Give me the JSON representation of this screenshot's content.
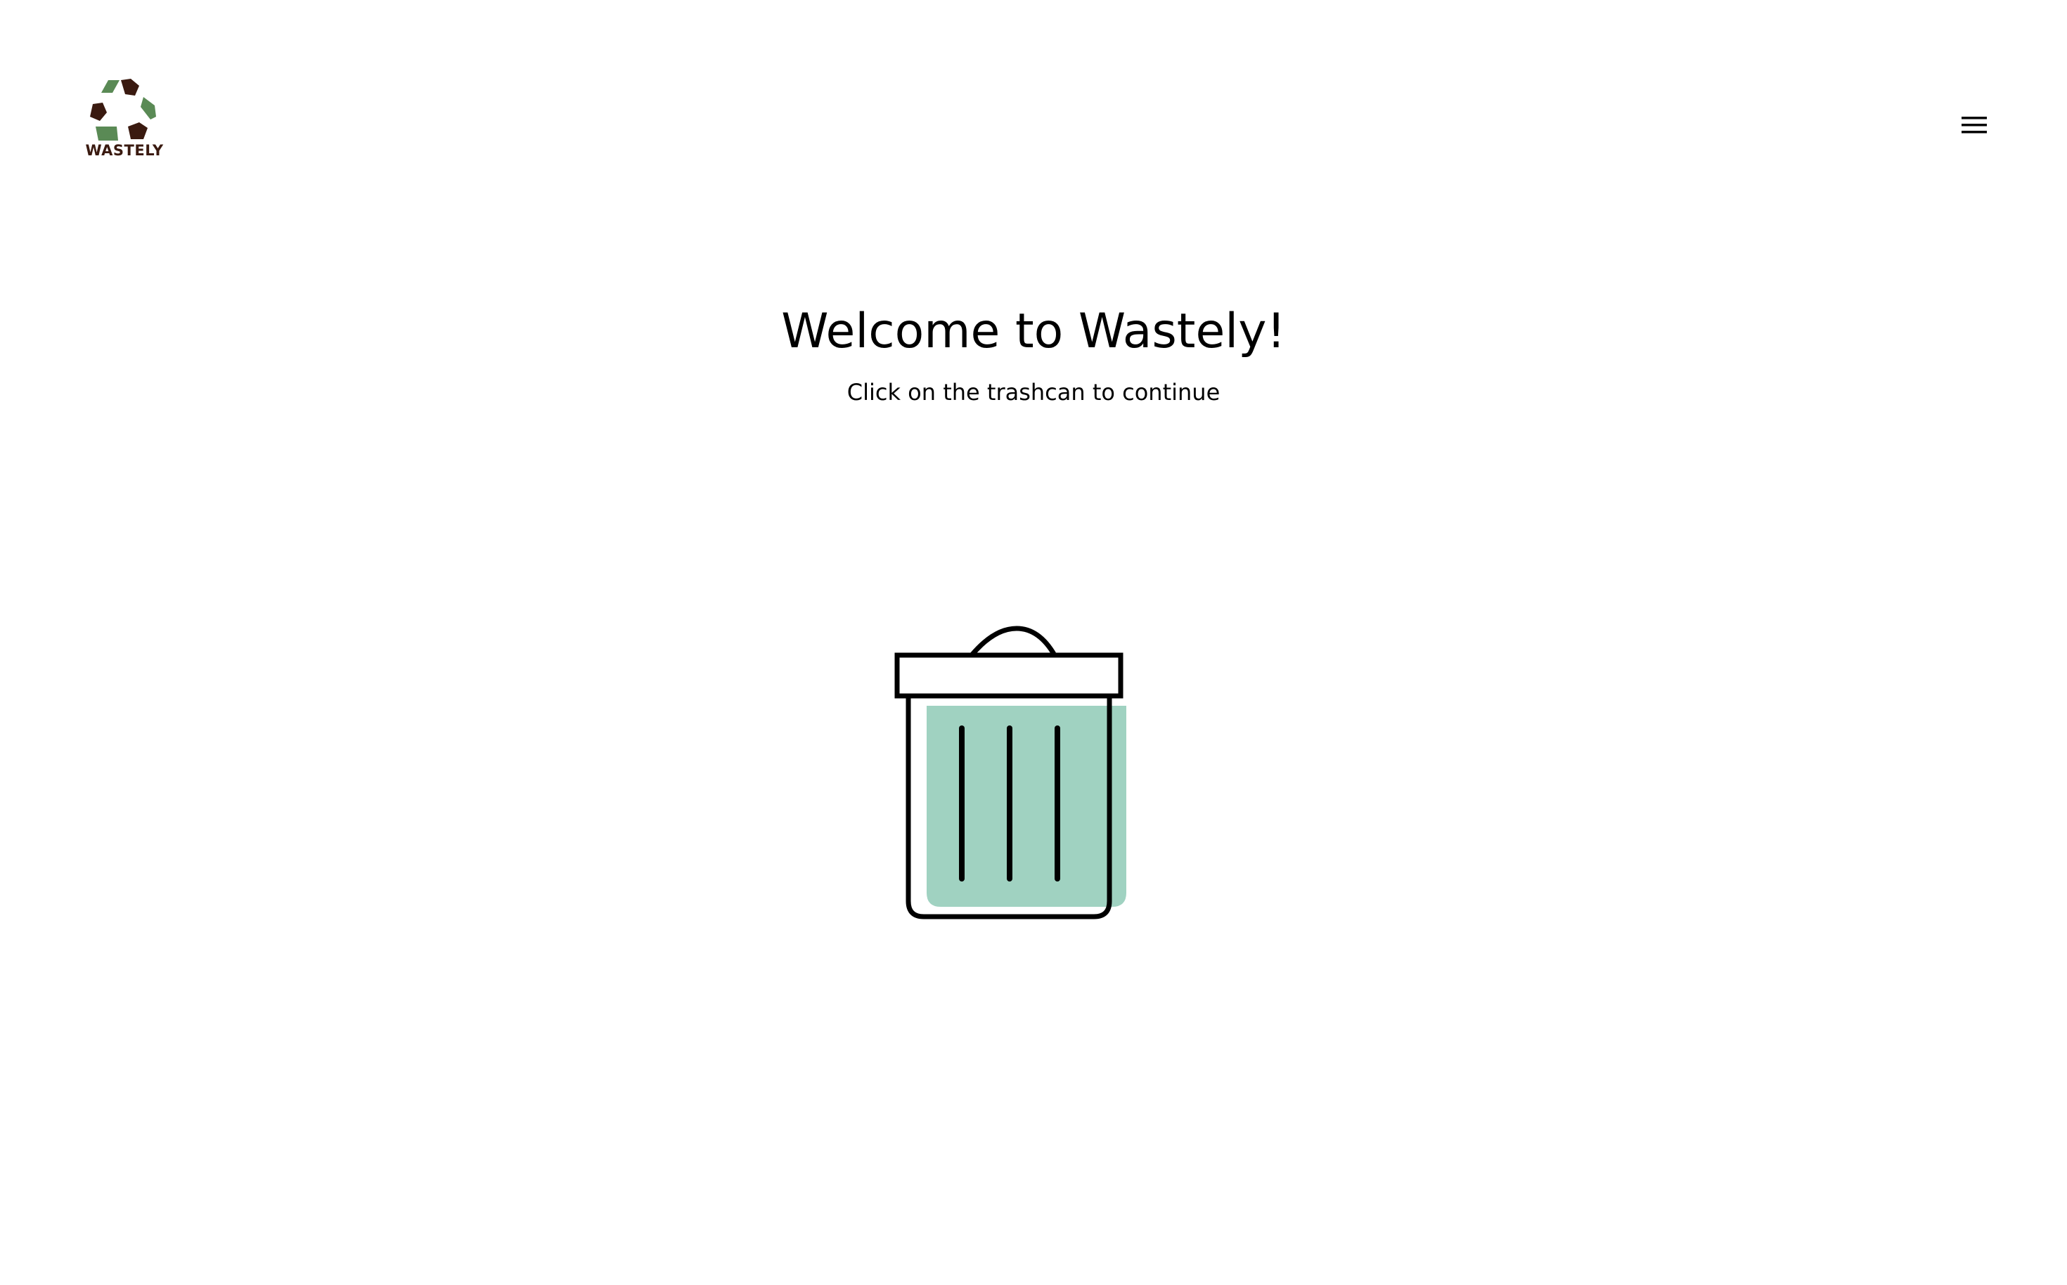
{
  "header": {
    "logo_text": "WASTELY",
    "menu_icon": "hamburger-menu-icon"
  },
  "main": {
    "title": "Welcome to Wastely!",
    "subtitle": "Click on the trashcan to continue",
    "trashcan_icon": "trashcan-icon"
  },
  "colors": {
    "logo_green": "#5a8a55",
    "logo_brown": "#3a1a10",
    "trash_fill": "#a0d2c1",
    "stroke": "#000000",
    "background": "#ffffff"
  }
}
